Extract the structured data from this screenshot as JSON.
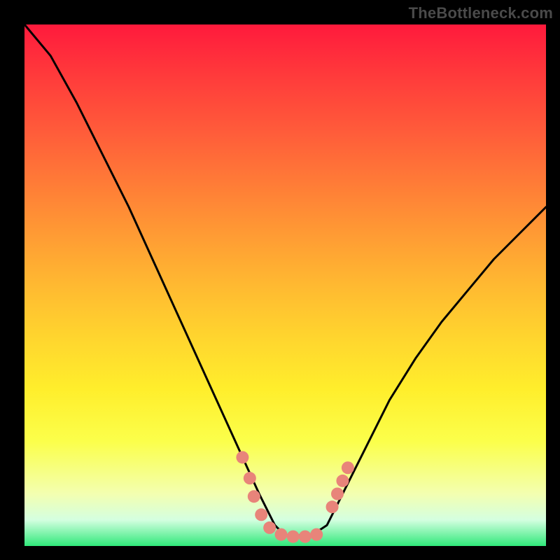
{
  "watermark": "TheBottleneck.com",
  "chart_data": {
    "type": "line",
    "title": "",
    "xlabel": "",
    "ylabel": "",
    "xlim": [
      0,
      1
    ],
    "ylim": [
      0,
      1
    ],
    "background_gradient": {
      "top": "#ff1a3c",
      "middle": "#ffee2c",
      "bottom": "#30e87a"
    },
    "series": [
      {
        "name": "curve",
        "color": "#000000",
        "x": [
          0.0,
          0.05,
          0.1,
          0.15,
          0.2,
          0.25,
          0.3,
          0.35,
          0.4,
          0.45,
          0.48,
          0.5,
          0.55,
          0.58,
          0.6,
          0.65,
          0.7,
          0.75,
          0.8,
          0.85,
          0.9,
          0.95,
          1.0
        ],
        "y": [
          1.0,
          0.94,
          0.85,
          0.75,
          0.65,
          0.54,
          0.43,
          0.32,
          0.21,
          0.1,
          0.04,
          0.02,
          0.02,
          0.04,
          0.08,
          0.18,
          0.28,
          0.36,
          0.43,
          0.49,
          0.55,
          0.6,
          0.65
        ]
      }
    ],
    "markers": [
      {
        "x": 0.418,
        "y": 0.17,
        "r": 9,
        "color": "#e8847a"
      },
      {
        "x": 0.432,
        "y": 0.13,
        "r": 9,
        "color": "#e8847a"
      },
      {
        "x": 0.44,
        "y": 0.095,
        "r": 9,
        "color": "#e8847a"
      },
      {
        "x": 0.454,
        "y": 0.06,
        "r": 9,
        "color": "#e8847a"
      },
      {
        "x": 0.47,
        "y": 0.035,
        "r": 9,
        "color": "#e8847a"
      },
      {
        "x": 0.492,
        "y": 0.022,
        "r": 9,
        "color": "#e8847a"
      },
      {
        "x": 0.515,
        "y": 0.018,
        "r": 9,
        "color": "#e8847a"
      },
      {
        "x": 0.538,
        "y": 0.018,
        "r": 9,
        "color": "#e8847a"
      },
      {
        "x": 0.56,
        "y": 0.022,
        "r": 9,
        "color": "#e8847a"
      },
      {
        "x": 0.59,
        "y": 0.075,
        "r": 9,
        "color": "#e8847a"
      },
      {
        "x": 0.6,
        "y": 0.1,
        "r": 9,
        "color": "#e8847a"
      },
      {
        "x": 0.61,
        "y": 0.125,
        "r": 9,
        "color": "#e8847a"
      },
      {
        "x": 0.62,
        "y": 0.15,
        "r": 9,
        "color": "#e8847a"
      }
    ]
  }
}
